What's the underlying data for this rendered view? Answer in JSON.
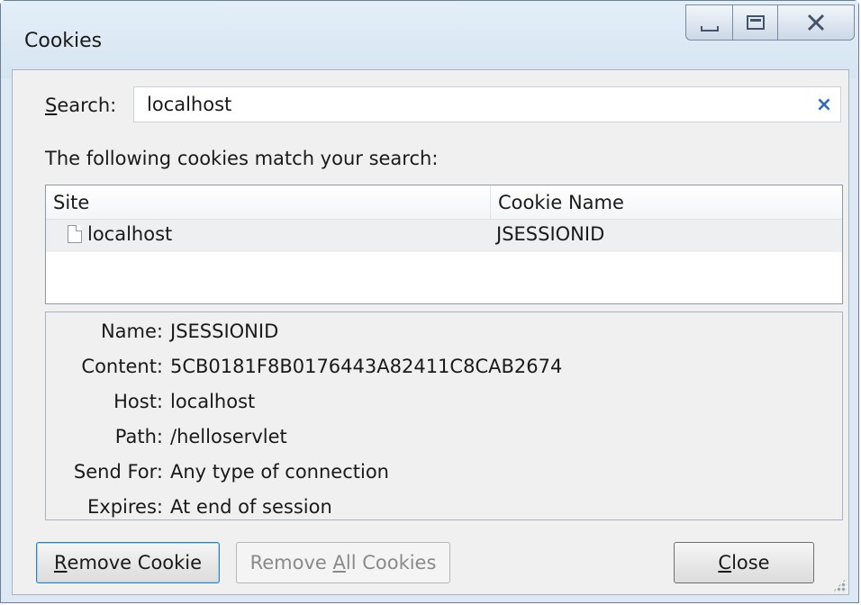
{
  "window": {
    "title": "Cookies"
  },
  "search": {
    "label_accel": "S",
    "label_rest": "earch:",
    "value": "localhost",
    "clear_glyph": "×"
  },
  "match_text": "The following cookies match your search:",
  "table": {
    "columns": [
      "Site",
      "Cookie Name"
    ],
    "rows": [
      {
        "site": "localhost",
        "cookie_name": "JSESSIONID"
      }
    ]
  },
  "details": [
    {
      "key": "Name:",
      "value": "JSESSIONID"
    },
    {
      "key": "Content:",
      "value": "5CB0181F8B0176443A82411C8CAB2674"
    },
    {
      "key": "Host:",
      "value": "localhost"
    },
    {
      "key": "Path:",
      "value": "/helloservlet"
    },
    {
      "key": "Send For:",
      "value": "Any type of connection"
    },
    {
      "key": "Expires:",
      "value": "At end of session"
    }
  ],
  "buttons": {
    "remove_accel": "R",
    "remove_rest": "emove Cookie",
    "remove_all_pre": "Remove ",
    "remove_all_accel": "A",
    "remove_all_post": "ll Cookies",
    "close_accel": "C",
    "close_rest": "lose"
  },
  "icons": {
    "minimize": "minimize-icon",
    "maximize": "maximize-icon",
    "close": "close-icon",
    "clear": "clear-search-icon",
    "row": "document-icon"
  },
  "colors": {
    "title_bar": "#dce8f3",
    "dialog_bg": "#f0f0f0",
    "clear_icon": "#2d6bb8",
    "default_button_border": "#3c7fb1"
  }
}
